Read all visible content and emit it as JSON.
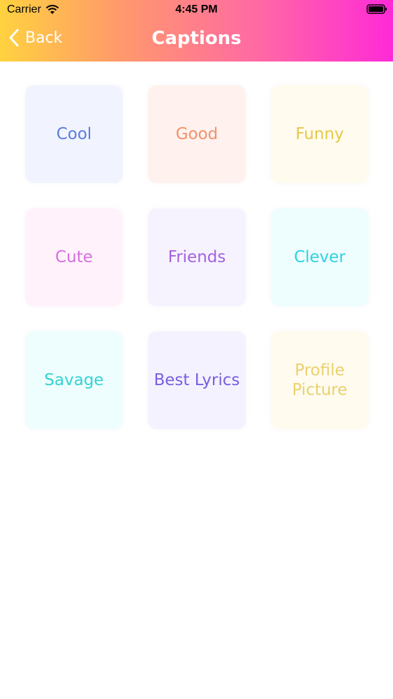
{
  "status_bar": {
    "carrier": "Carrier",
    "time": "4:45 PM",
    "wifi_icon": "wifi-icon",
    "battery_icon": "battery-icon"
  },
  "nav": {
    "back_label": "Back",
    "back_icon": "chevron-left-icon",
    "title": "Captions"
  },
  "categories": [
    {
      "label": "Cool",
      "text_color": "#5b7be0",
      "bg": "#f1f4ff"
    },
    {
      "label": "Good",
      "text_color": "#f0936a",
      "bg": "#fff1ee"
    },
    {
      "label": "Funny",
      "text_color": "#e6c84a",
      "bg": "#fffbee"
    },
    {
      "label": "Cute",
      "text_color": "#d66ee0",
      "bg": "#fff2fb"
    },
    {
      "label": "Friends",
      "text_color": "#a460dd",
      "bg": "#f6f3ff"
    },
    {
      "label": "Clever",
      "text_color": "#2dd1e3",
      "bg": "#eefdfd"
    },
    {
      "label": "Savage",
      "text_color": "#35d3d3",
      "bg": "#eefdfd"
    },
    {
      "label": "Best Lyrics",
      "text_color": "#7a5ee0",
      "bg": "#f4f2ff"
    },
    {
      "label": "Profile Picture",
      "text_color": "#ead16e",
      "bg": "#fffbef"
    }
  ]
}
